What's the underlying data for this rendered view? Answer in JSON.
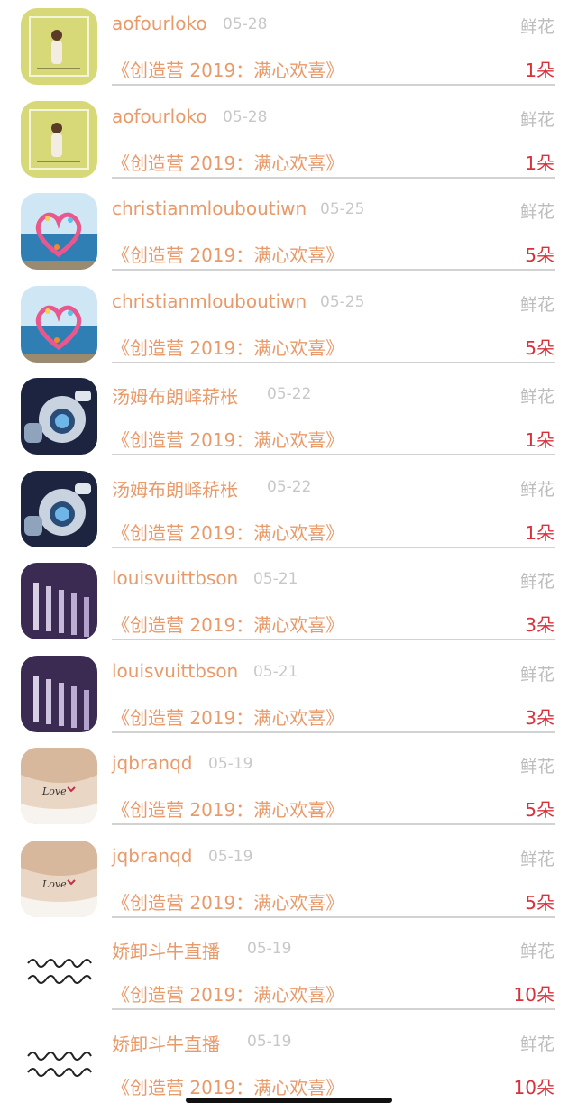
{
  "gift_list": {
    "items": [
      {
        "username": "aofourloko",
        "date": "05-28",
        "gift_type": "鲜花",
        "program": "《创造营 2019：满心欢喜》",
        "count": "1朵",
        "avatar_icon": "yellow-wall-girl-avatar"
      },
      {
        "username": "aofourloko",
        "date": "05-28",
        "gift_type": "鲜花",
        "program": "《创造营 2019：满心欢喜》",
        "count": "1朵",
        "avatar_icon": "yellow-wall-girl-avatar"
      },
      {
        "username": "christianmlouboutiwn",
        "date": "05-25",
        "gift_type": "鲜花",
        "program": "《创造营 2019：满心欢喜》",
        "count": "5朵",
        "avatar_icon": "heart-ocean-avatar"
      },
      {
        "username": "christianmlouboutiwn",
        "date": "05-25",
        "gift_type": "鲜花",
        "program": "《创造营 2019：满心欢喜》",
        "count": "5朵",
        "avatar_icon": "heart-ocean-avatar"
      },
      {
        "username": "汤姆布朗峄菥枨",
        "date": "05-22",
        "gift_type": "鲜花",
        "program": "《创造营 2019：满心欢喜》",
        "count": "1朵",
        "avatar_icon": "robot-avatar"
      },
      {
        "username": "汤姆布朗峄菥枨",
        "date": "05-22",
        "gift_type": "鲜花",
        "program": "《创造营 2019：满心欢喜》",
        "count": "1朵",
        "avatar_icon": "robot-avatar"
      },
      {
        "username": "louisvuittbson",
        "date": "05-21",
        "gift_type": "鲜花",
        "program": "《创造营 2019：满心欢喜》",
        "count": "3朵",
        "avatar_icon": "purple-columns-avatar"
      },
      {
        "username": "louisvuittbson",
        "date": "05-21",
        "gift_type": "鲜花",
        "program": "《创造营 2019：满心欢喜》",
        "count": "3朵",
        "avatar_icon": "purple-columns-avatar"
      },
      {
        "username": "jqbranqd",
        "date": "05-19",
        "gift_type": "鲜花",
        "program": "《创造营 2019：满心欢喜》",
        "count": "5朵",
        "avatar_icon": "tattoo-shoulder-avatar"
      },
      {
        "username": "jqbranqd",
        "date": "05-19",
        "gift_type": "鲜花",
        "program": "《创造营 2019：满心欢喜》",
        "count": "5朵",
        "avatar_icon": "tattoo-shoulder-avatar"
      },
      {
        "username": "娇卸斗牛直播",
        "date": "05-19",
        "gift_type": "鲜花",
        "program": "《创造营 2019：满心欢喜》",
        "count": "10朵",
        "avatar_icon": "handwriting-avatar"
      },
      {
        "username": "娇卸斗牛直播",
        "date": "05-19",
        "gift_type": "鲜花",
        "program": "《创造营 2019：满心欢喜》",
        "count": "10朵",
        "avatar_icon": "handwriting-avatar"
      }
    ]
  },
  "colors": {
    "accent": "#e89a6a",
    "count": "#d9303a",
    "muted": "#bdbdbd",
    "divider": "#d2d2d2"
  }
}
